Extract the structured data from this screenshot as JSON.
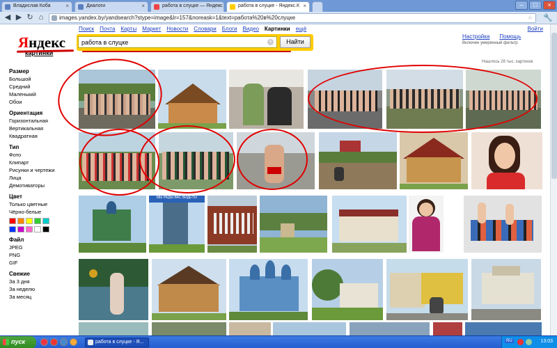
{
  "browser": {
    "tabs": [
      {
        "label": "Владислав Коба",
        "active": false
      },
      {
        "label": "Диалоги",
        "active": false
      },
      {
        "label": "работа в слуцке — Яндекс",
        "active": false
      },
      {
        "label": "работа в слуцке - Яндекс.К",
        "active": true
      }
    ],
    "url": "images.yandex.by/yandsearch?stype=image&lr=157&noreask=1&text=работа%20в%20слуцке"
  },
  "header": {
    "logo_text": "Яндекс",
    "logo_first_letter": "Я",
    "logo_rest": "ндекс",
    "logo_sub": "картинки",
    "services": [
      {
        "label": "Поиск",
        "selected": false
      },
      {
        "label": "Почта",
        "selected": false
      },
      {
        "label": "Карты",
        "selected": false
      },
      {
        "label": "Маркет",
        "selected": false
      },
      {
        "label": "Новости",
        "selected": false
      },
      {
        "label": "Словари",
        "selected": false
      },
      {
        "label": "Блоги",
        "selected": false
      },
      {
        "label": "Видео",
        "selected": false
      },
      {
        "label": "Картинки",
        "selected": true
      },
      {
        "label": "ещё",
        "selected": false
      }
    ],
    "login": "Войти",
    "settings": "Настройка",
    "help": "Помощь",
    "filter_note": "Включен умеренный фильтр"
  },
  "search": {
    "query": "работа в слуцке",
    "button_label": "Найти"
  },
  "results": {
    "count_text": "Нашлось 28 тыс. картинок"
  },
  "sidebar": {
    "sections": [
      {
        "title": "Размер",
        "items": [
          "Большой",
          "Средний",
          "Маленький",
          "Обои"
        ]
      },
      {
        "title": "Ориентация",
        "items": [
          "Горизонтальная",
          "Вертикальная",
          "Квадратная"
        ]
      },
      {
        "title": "Тип",
        "items": [
          "Фото",
          "Клипарт",
          "Рисунки и чертежи",
          "Лица",
          "Демотиваторы"
        ]
      },
      {
        "title": "Цвет",
        "items": [
          "Только цветные",
          "Чёрно-белые"
        ]
      },
      {
        "title": "Файл",
        "items": [
          "JPEG",
          "PNG",
          "GIF"
        ]
      },
      {
        "title": "Свежие",
        "items": [
          "За 3 дня",
          "За неделю",
          "За месяц"
        ]
      }
    ],
    "colors": [
      "#ff0000",
      "#ff8800",
      "#ffff00",
      "#33cc33",
      "#00cccc",
      "#0033ff",
      "#cc00cc",
      "#ff66cc",
      "#ffffff",
      "#000000"
    ]
  },
  "taskbar": {
    "start_label": "пуск",
    "task_label": "работа в слуцке - Я...",
    "lang": "RU",
    "clock": "13:03"
  },
  "images": {
    "banner_text": "МЫ РАДЫ ВАС ВИДЕТЬ!"
  }
}
